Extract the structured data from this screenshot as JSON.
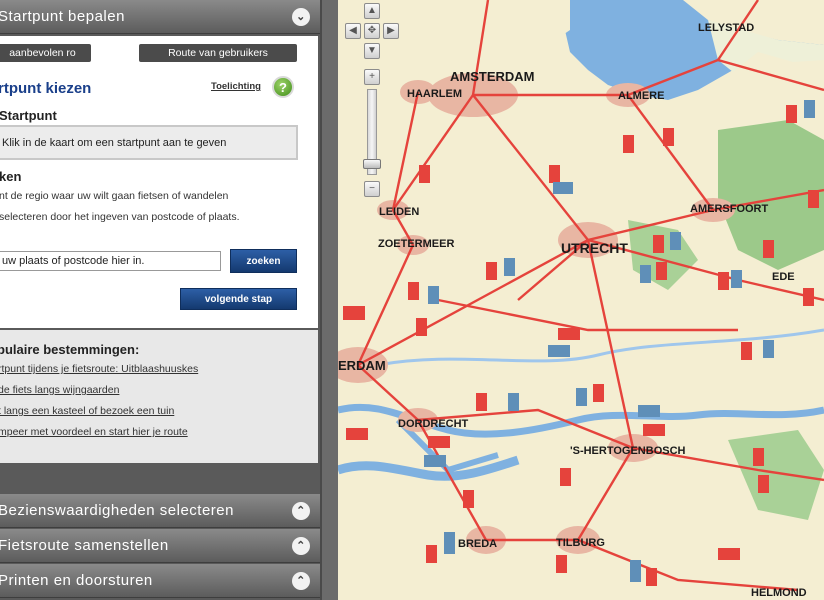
{
  "sidebar": {
    "top_header": {
      "title": "Startpunt bepalen",
      "toggle_glyph": "⌄",
      "toggle_icon": "chevron-down-icon"
    },
    "tabs": [
      {
        "label": "aanbevolen ro"
      },
      {
        "label": "Route van gebruikers"
      }
    ],
    "section_title": "rtpunt kiezen",
    "help_link": "Toelichting",
    "help_icon": "?",
    "startpunt_label": "Startpunt",
    "click_hint": "Klik in de kaart om een startpunt aan te geven",
    "zoeken_label": "ken",
    "desc_line_1": "nt de regio waar uw wilt gaan fietsen of wandelen",
    "desc_line_2": "selecteren door het ingeven van postcode of plaats.",
    "search_value": "uw plaats of postcode hier in.",
    "search_button": "zoeken",
    "next_button": "volgende stap",
    "popular_title": "pulaire bestemmingen:",
    "popular_links": [
      "rtpunt tijdens je fietsroute: Uitblaashuuskes",
      "de fiets langs wijngaarden",
      "t langs een kasteel of bezoek een tuin",
      "mpeer met voordeel en start hier je route"
    ],
    "bottom_headers": [
      {
        "title": "Bezienswaardigheden selecteren",
        "toggle_glyph": "⌃"
      },
      {
        "title": "Fietsroute samenstellen",
        "toggle_glyph": "⌃"
      },
      {
        "title": "Printen en doorsturen",
        "toggle_glyph": "⌃"
      }
    ]
  },
  "map": {
    "controls": {
      "pan_up": "▲",
      "pan_left": "◀",
      "pan_center": "✥",
      "pan_right": "▶",
      "pan_down": "▼",
      "zoom_in": "+",
      "zoom_out": "−"
    },
    "cities": [
      {
        "name": "LELYSTAD"
      },
      {
        "name": "AMSTERDAM"
      },
      {
        "name": "HAARLEM"
      },
      {
        "name": "ALMERE"
      },
      {
        "name": "LEIDEN"
      },
      {
        "name": "AMERSFOORT"
      },
      {
        "name": "ZOETERMEER"
      },
      {
        "name": "UTRECHT"
      },
      {
        "name": "EDE"
      },
      {
        "name": "ERDAM"
      },
      {
        "name": "DORDRECHT"
      },
      {
        "name": "'S-HERTOGENBOSCH"
      },
      {
        "name": "BREDA"
      },
      {
        "name": "TILBURG"
      },
      {
        "name": "HELMOND"
      }
    ],
    "colors": {
      "land": "#f4eed2",
      "water": "#7fb1e0",
      "forest": "#9cc98a",
      "urban": "#e8b6a3",
      "road": "#e5433c",
      "marker_red": "#e5433c",
      "marker_blue": "#5f8fb8"
    }
  }
}
